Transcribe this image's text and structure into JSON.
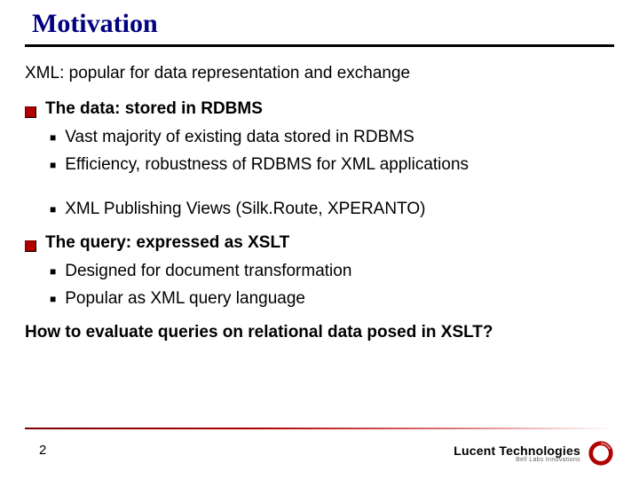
{
  "title": "Motivation",
  "intro": "XML: popular for data representation and exchange",
  "sections": [
    {
      "head": "The data: stored in RDBMS",
      "items": [
        "Vast majority of existing data stored in RDBMS",
        "Efficiency, robustness of RDBMS for XML applications",
        "XML Publishing Views (Silk.Route, XPERANTO)"
      ]
    },
    {
      "head": "The query: expressed as XSLT",
      "items": [
        "Designed for document transformation",
        "Popular as XML query language"
      ]
    }
  ],
  "closing": "How to evaluate queries on relational data posed in XSLT?",
  "page_number": "2",
  "logo": {
    "main": "Lucent Technologies",
    "sub": "Bell Labs Innovations"
  },
  "colors": {
    "title": "#000080",
    "accent": "#b00000"
  }
}
